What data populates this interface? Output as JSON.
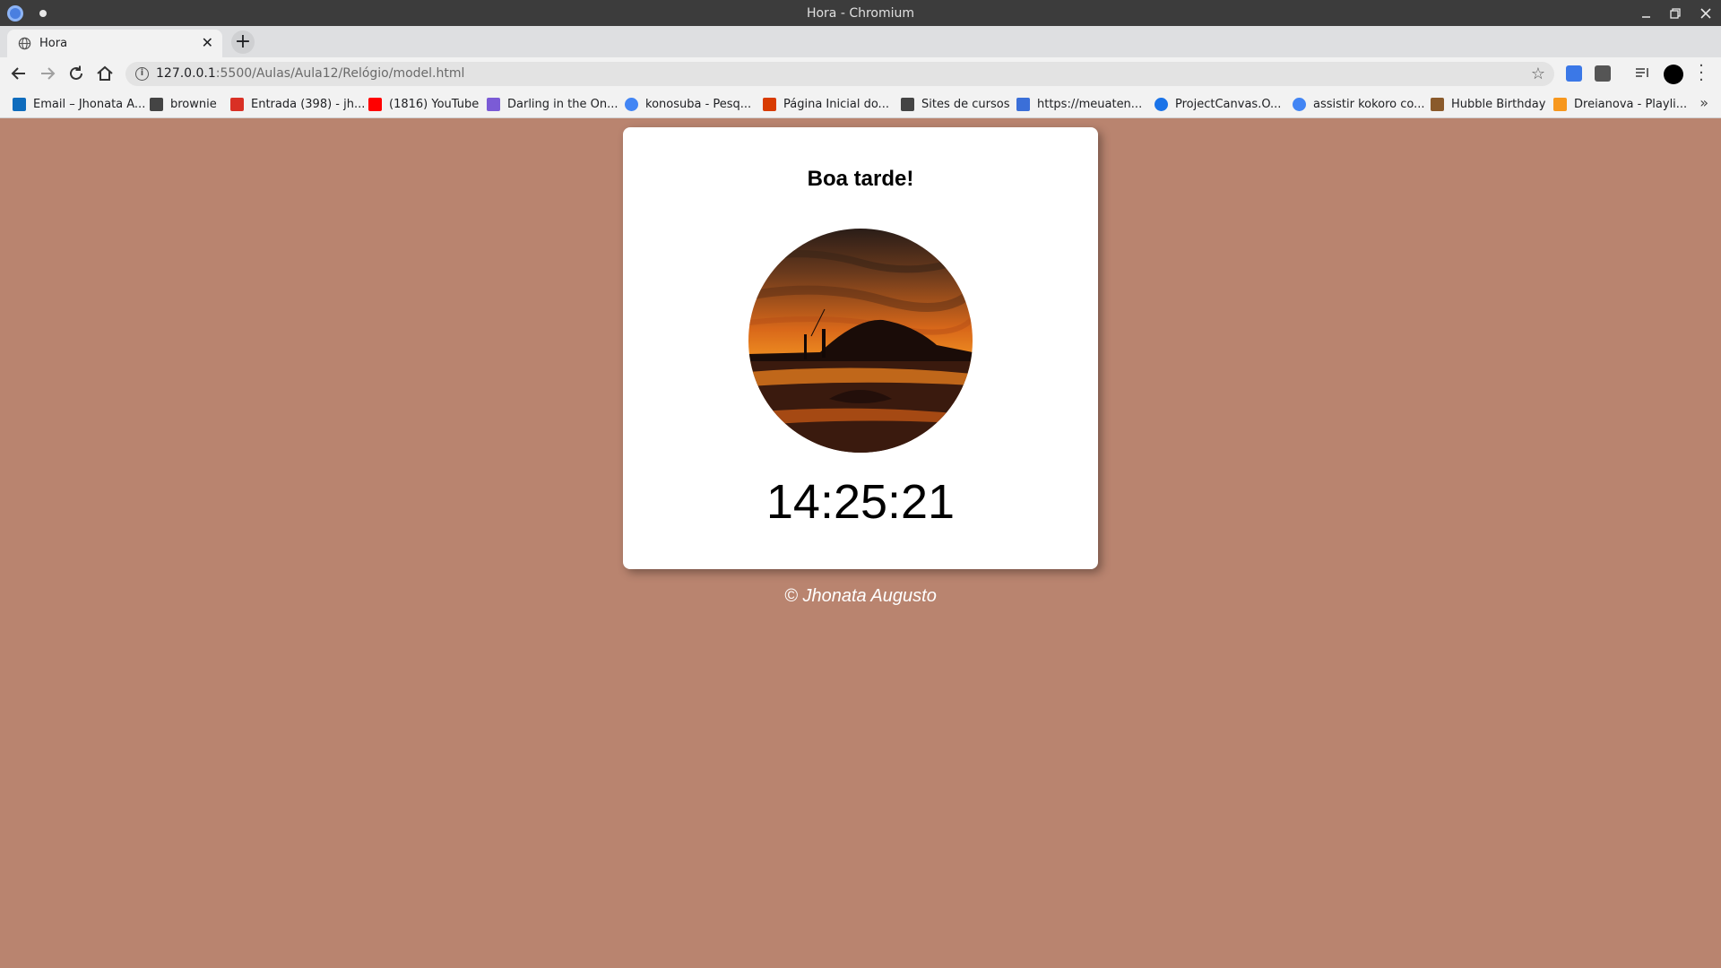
{
  "window": {
    "title": "Hora - Chromium"
  },
  "tab": {
    "title": "Hora"
  },
  "address_bar": {
    "url_host": "127.0.0.1",
    "url_rest": ":5500/Aulas/Aula12/Relógio/model.html"
  },
  "bookmarks": [
    {
      "label": "Email – Jhonata A...",
      "icon": "outlook-icon",
      "color": "#0f6cbd"
    },
    {
      "label": "brownie",
      "icon": "folder-icon",
      "color": "#444444"
    },
    {
      "label": "Entrada (398) - jh...",
      "icon": "gmail-icon",
      "color": "#d93025"
    },
    {
      "label": "(1816) YouTube",
      "icon": "youtube-icon",
      "color": "#ff0000"
    },
    {
      "label": "Darling in the On...",
      "icon": "anime-site-icon",
      "color": "#7b5bd6"
    },
    {
      "label": "konosuba - Pesq...",
      "icon": "google-icon",
      "color": "#4285f4"
    },
    {
      "label": "Página Inicial do...",
      "icon": "office-icon",
      "color": "#d83b01"
    },
    {
      "label": "Sites de cursos",
      "icon": "folder-icon",
      "color": "#444444"
    },
    {
      "label": "https://meuaten...",
      "icon": "site-icon",
      "color": "#3b6fd8"
    },
    {
      "label": "ProjectCanvas.O...",
      "icon": "canvas-icon",
      "color": "#1a73e8"
    },
    {
      "label": "assistir kokoro co...",
      "icon": "google-icon",
      "color": "#4285f4"
    },
    {
      "label": "Hubble Birthday",
      "icon": "hubble-icon",
      "color": "#8a5a2b"
    },
    {
      "label": "Dreianova - Playli...",
      "icon": "ph-icon",
      "color": "#f7971d"
    }
  ],
  "page": {
    "greeting": "Boa tarde!",
    "time": "14:25:21",
    "footer": "© Jhonata Augusto",
    "background_color": "#b9846f",
    "image": "sunset-beach-photo"
  }
}
